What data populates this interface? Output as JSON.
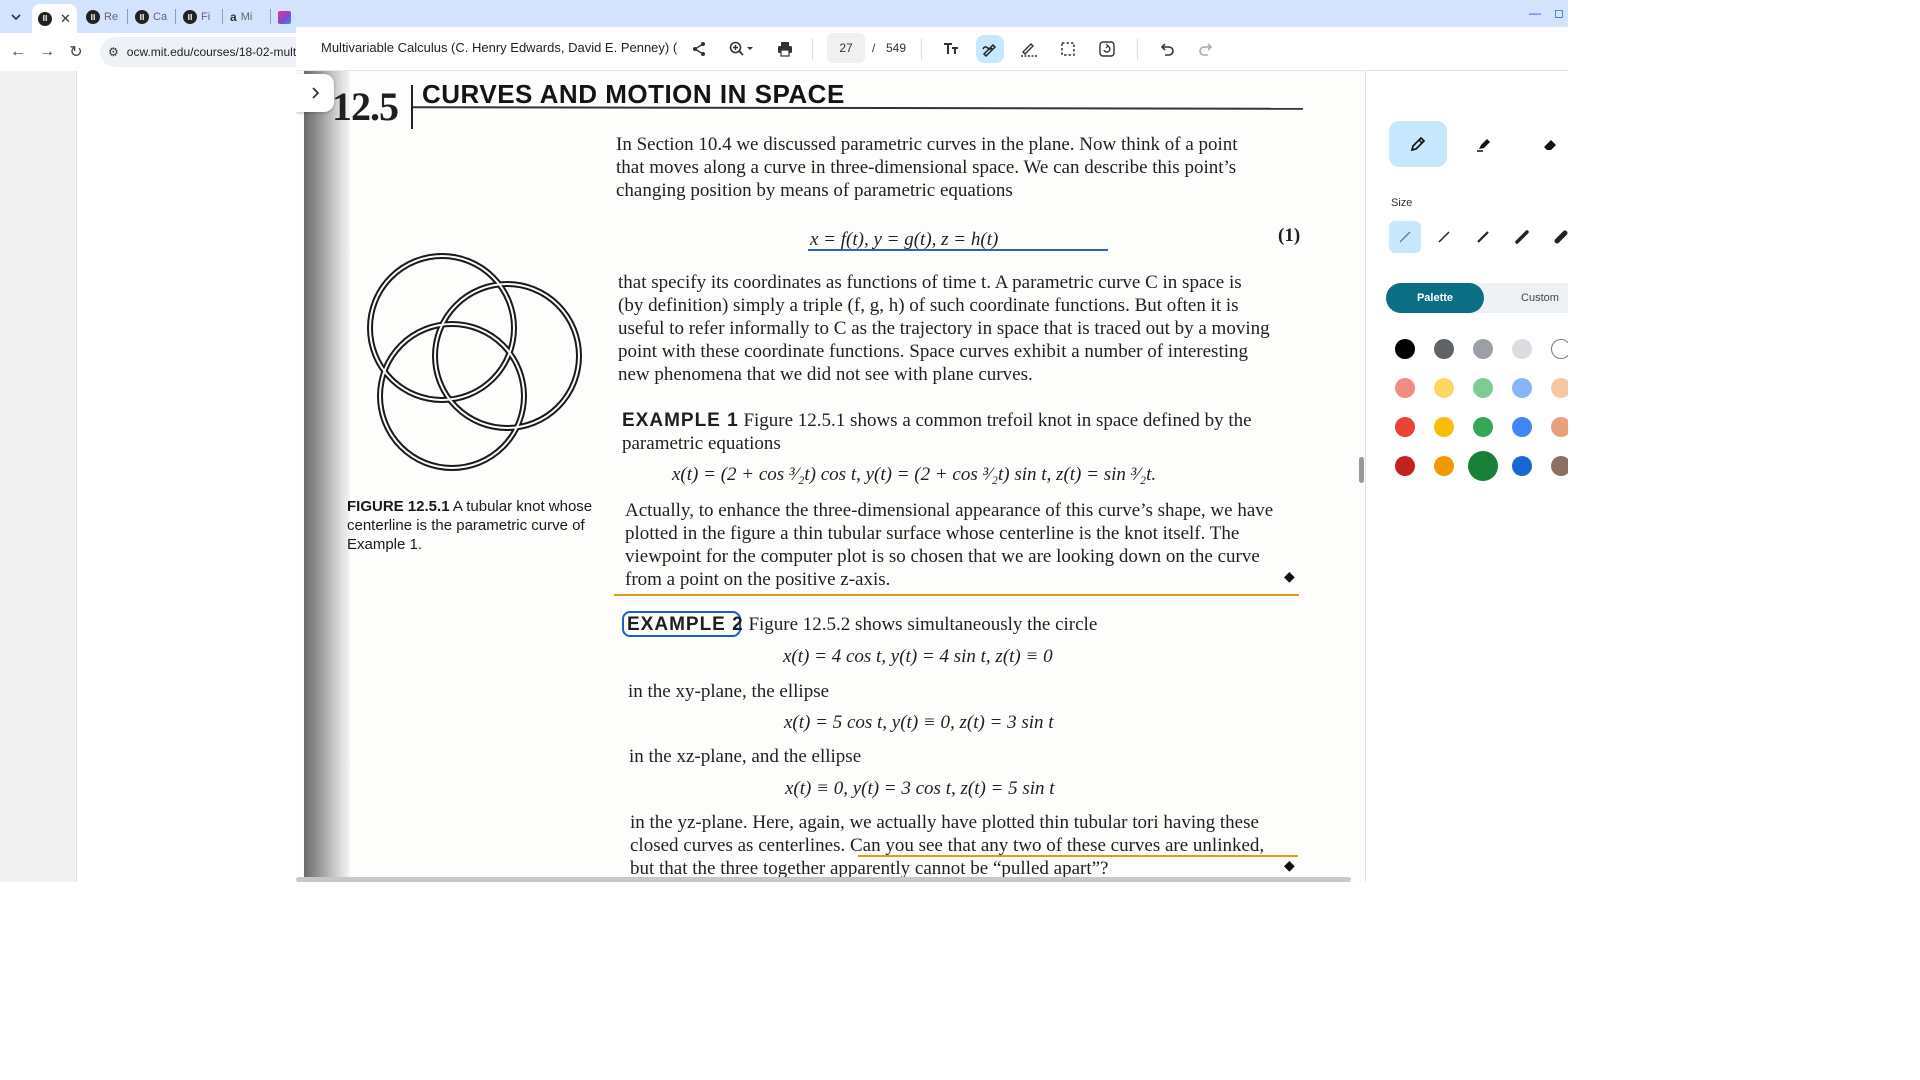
{
  "browser": {
    "tabs": [
      {
        "label": "",
        "active": true
      },
      {
        "label": "Re"
      },
      {
        "label": "Ca"
      },
      {
        "label": "Fi"
      },
      {
        "label": "Mi"
      }
    ],
    "url": "ocw.mit.edu/courses/18-02-mult"
  },
  "toolbar": {
    "title": "Multivariable Calculus (C. Henry Edwards, David E. Penney) (",
    "page_current": "27",
    "page_separator": "/",
    "page_total": "549"
  },
  "document": {
    "section_number": "12.5",
    "section_title": "CURVES AND MOTION IN SPACE",
    "intro_lines": [
      "In Section 10.4 we discussed parametric curves in the plane. Now think of a point",
      "that moves along a curve in three-dimensional space. We can describe this point’s",
      "changing position by means of parametric equations"
    ],
    "eq1": "x = f(t),      y = g(t),      z = h(t)",
    "eq1_number": "(1)",
    "para2_lines": [
      "that specify its coordinates as functions of time t. A parametric curve C in space is",
      "(by definition) simply a triple (f, g, h) of such coordinate functions. But often it is",
      "useful to refer informally to C as the trajectory in space that is traced out by a moving",
      "point with these coordinate functions. Space curves exhibit a number of interesting",
      "new phenomena that we did not see with plane curves."
    ],
    "ex1_label": "EXAMPLE 1",
    "ex1_line1": " Figure 12.5.1 shows a common trefoil knot in space defined by the",
    "ex1_line2": "parametric equations",
    "ex1_eq": "x(t) = (2 + cos ³⁄₂t) cos t,      y(t) = (2 + cos ³⁄₂t) sin t,      z(t) = sin ³⁄₂t.",
    "ex1_para_lines": [
      "Actually, to enhance the three-dimensional appearance of this curve’s shape, we have",
      "plotted in the figure a thin tubular surface whose centerline is the knot itself. The",
      "viewpoint for the computer plot is so chosen that we are looking down on the curve",
      "from a point on the positive z-axis."
    ],
    "diamond": "◆",
    "ex2_label": "EXAMPLE 2",
    "ex2_line1": " Figure 12.5.2 shows simultaneously the circle",
    "ex2_eq1": "x(t) = 4 cos t,      y(t) = 4 sin t,      z(t) ≡ 0",
    "ex2_text1": "in the xy-plane, the ellipse",
    "ex2_eq2": "x(t) = 5 cos t,      y(t) ≡ 0,      z(t) = 3 sin t",
    "ex2_text2": "in the xz-plane, and the ellipse",
    "ex2_eq3": "x(t) ≡ 0,      y(t) = 3 cos t,      z(t) = 5 sin t",
    "ex2_final_line1": "in the yz-plane. Here, again, we actually have plotted thin tubular tori having these",
    "ex2_final_line2a": "closed curves as centerlines. ",
    "ex2_final_line2b": "Can you see that any two of these curves are unlinked,",
    "ex2_final_line3": "but that the three together apparently cannot be “pulled apart”?",
    "fig_caption_label": "FIGURE 12.5.1",
    "fig_caption_text": " A tubular knot whose centerline is the parametric curve of Example 1."
  },
  "annotation_panel": {
    "size_label": "Size",
    "tab_palette": "Palette",
    "tab_custom": "Custom",
    "swatches": [
      [
        "#000000",
        "#5f6368",
        "#9aa0a6",
        "#dadce0",
        "#ffffff"
      ],
      [
        "#f28b82",
        "#fdd663",
        "#81c995",
        "#8ab4f8",
        "#f6c7a5"
      ],
      [
        "#ea4335",
        "#fbbc04",
        "#34a853",
        "#4285f4",
        "#e8a07a"
      ],
      [
        "#c5221f",
        "#f29900",
        "#188038",
        "#1967d2",
        "#8d6e63"
      ]
    ],
    "selected_swatch": "#188038"
  },
  "colors": {
    "accent": "#0b6e83",
    "highlight": "#c7e7ff",
    "annotation_blue": "#2a61c9",
    "annotation_orange": "#e39b16"
  }
}
